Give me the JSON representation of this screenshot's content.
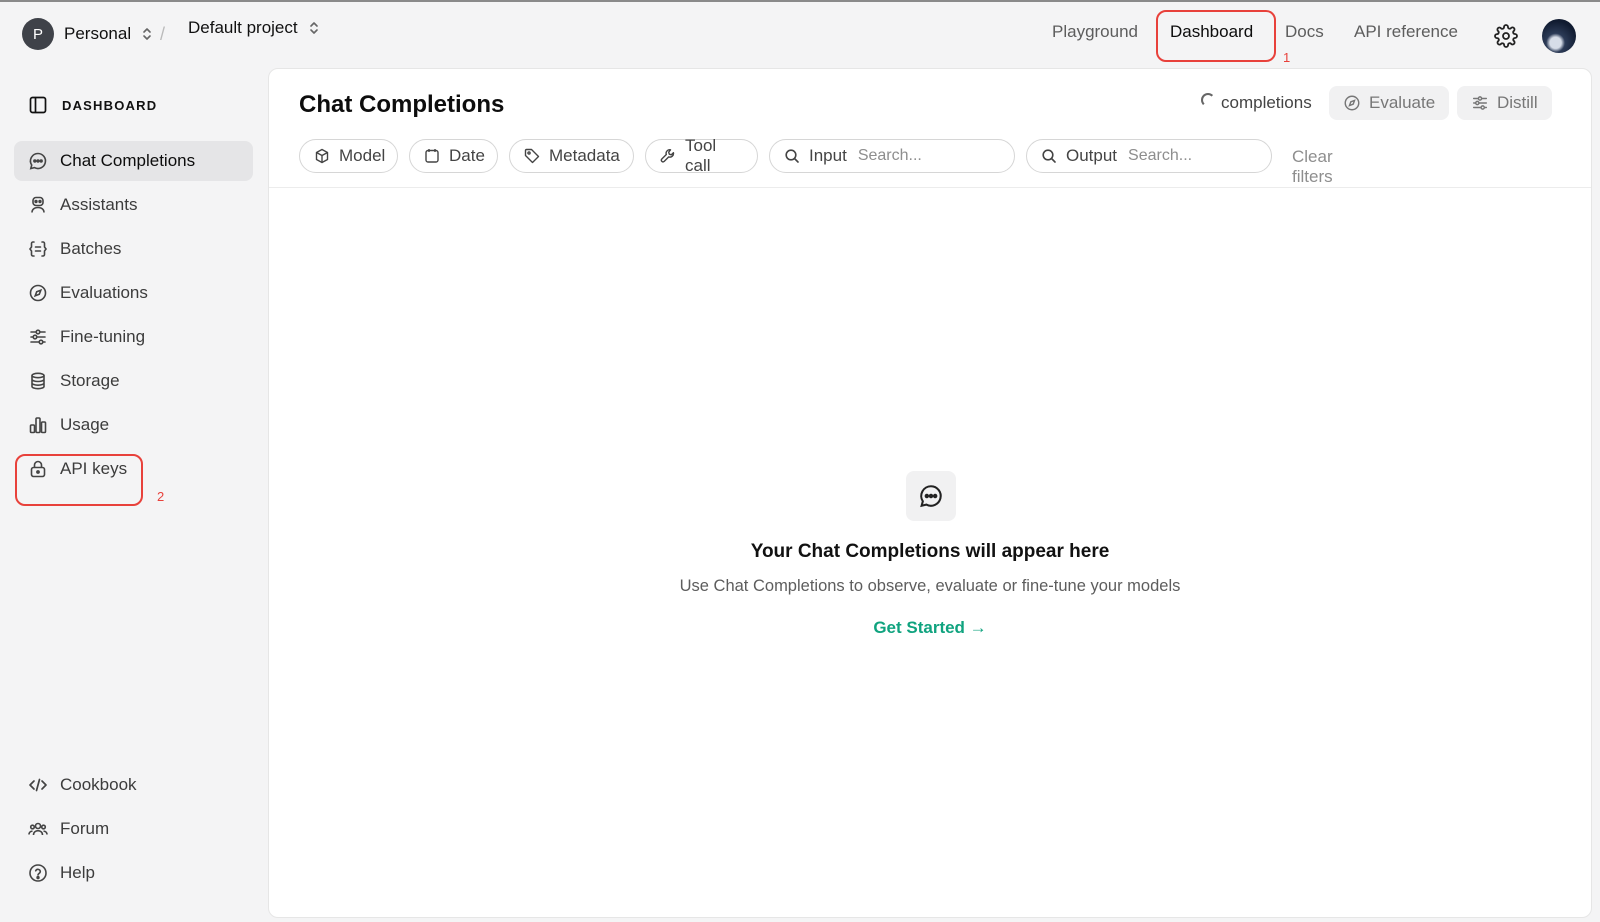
{
  "header": {
    "workspace": {
      "initial": "P",
      "name": "Personal"
    },
    "separator": "/",
    "project": "Default project",
    "nav": {
      "playground": "Playground",
      "dashboard": "Dashboard",
      "docs": "Docs",
      "api_reference": "API reference"
    }
  },
  "annotations": {
    "first": "1",
    "second": "2",
    "color": "#e8413b"
  },
  "sidebar": {
    "heading": "DASHBOARD",
    "items": [
      {
        "label": "Chat Completions",
        "icon": "chat-icon",
        "active": true
      },
      {
        "label": "Assistants",
        "icon": "robot-icon"
      },
      {
        "label": "Batches",
        "icon": "braces-icon"
      },
      {
        "label": "Evaluations",
        "icon": "compass-icon"
      },
      {
        "label": "Fine-tuning",
        "icon": "sliders-icon"
      },
      {
        "label": "Storage",
        "icon": "database-icon"
      },
      {
        "label": "Usage",
        "icon": "bar-chart-icon"
      },
      {
        "label": "API keys",
        "icon": "lock-icon"
      }
    ],
    "footer": [
      {
        "label": "Cookbook",
        "icon": "code-icon"
      },
      {
        "label": "Forum",
        "icon": "people-icon"
      },
      {
        "label": "Help",
        "icon": "help-icon"
      }
    ]
  },
  "main": {
    "title": "Chat Completions",
    "status_label": "completions",
    "evaluate_label": "Evaluate",
    "distill_label": "Distill",
    "filters": {
      "model": "Model",
      "date": "Date",
      "metadata": "Metadata",
      "tool_call": "Tool call",
      "input_label": "Input",
      "input_placeholder": "Search...",
      "output_label": "Output",
      "output_placeholder": "Search...",
      "clear": "Clear filters"
    },
    "empty": {
      "title": "Your Chat Completions will appear here",
      "subtitle": "Use Chat Completions to observe, evaluate or fine-tune your models",
      "cta": "Get Started →"
    }
  },
  "colors": {
    "accent": "#10a37f",
    "annotation": "#e8413b",
    "active_bg": "#e5e5e7"
  }
}
